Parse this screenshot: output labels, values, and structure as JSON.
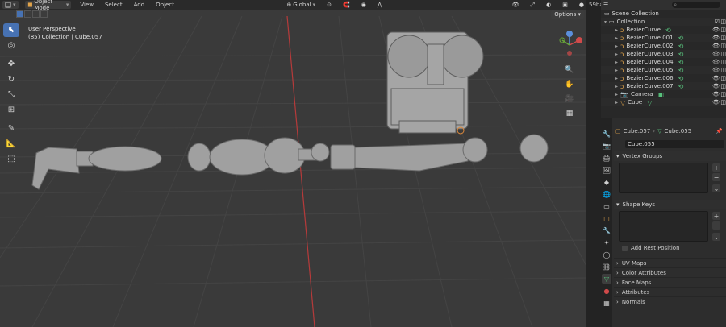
{
  "header": {
    "mode": "Object Mode",
    "menus": [
      "View",
      "Select",
      "Add",
      "Object"
    ],
    "transform_orientation": "Global",
    "options": "Options"
  },
  "viewport": {
    "perspective": "User Perspective",
    "collection_info": "(85) Collection | Cube.057"
  },
  "right_strip_label": "59ba",
  "outliner": {
    "root": "Scene Collection",
    "collection": "Collection",
    "items": [
      {
        "name": "BezierCurve",
        "type": "curve"
      },
      {
        "name": "BezierCurve.001",
        "type": "curve"
      },
      {
        "name": "BezierCurve.002",
        "type": "curve"
      },
      {
        "name": "BezierCurve.003",
        "type": "curve"
      },
      {
        "name": "BezierCurve.004",
        "type": "curve"
      },
      {
        "name": "BezierCurve.005",
        "type": "curve"
      },
      {
        "name": "BezierCurve.006",
        "type": "curve"
      },
      {
        "name": "BezierCurve.007",
        "type": "curve"
      },
      {
        "name": "Camera",
        "type": "camera"
      },
      {
        "name": "Cube",
        "type": "mesh"
      }
    ]
  },
  "properties": {
    "breadcrumb_object": "Cube.057",
    "breadcrumb_data": "Cube.055",
    "mesh_name": "Cube.055",
    "panels": {
      "vertex_groups": "Vertex Groups",
      "shape_keys": "Shape Keys",
      "add_rest_position": "Add Rest Position",
      "uv_maps": "UV Maps",
      "color_attributes": "Color Attributes",
      "face_maps": "Face Maps",
      "attributes": "Attributes",
      "normals": "Normals"
    }
  },
  "colors": {
    "accent": "#4772b3",
    "viewport_bg": "#3a3a3a",
    "grid": "#454545",
    "axis_red": "#b63a3a",
    "mesh": "#9c9c9c"
  }
}
